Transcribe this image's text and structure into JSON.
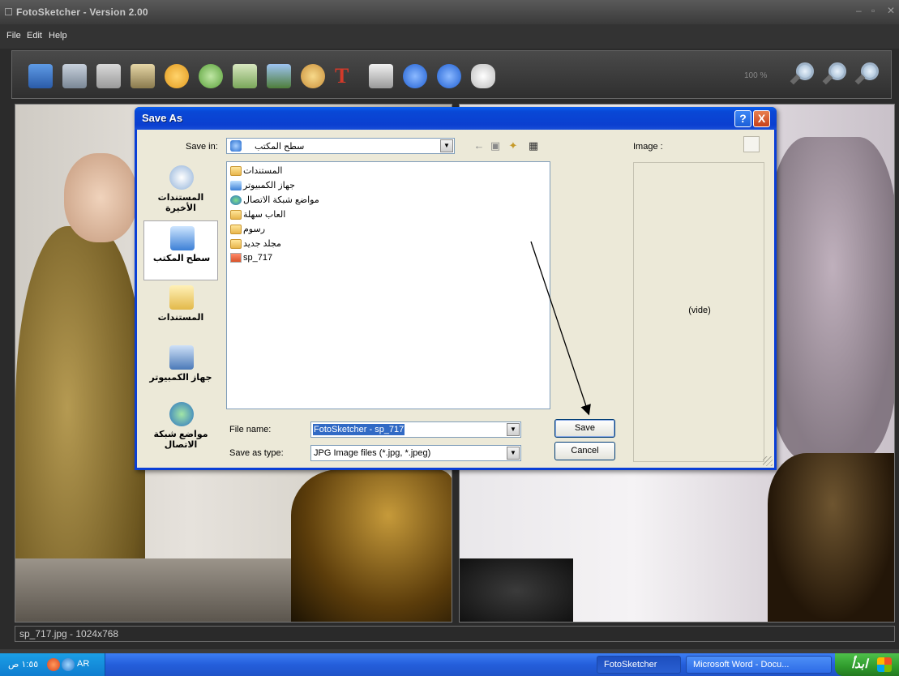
{
  "app": {
    "title": "FotoSketcher - Version 2.00",
    "menu": [
      "File",
      "Edit",
      "Help"
    ],
    "zoom_level": "100 %",
    "status": "sp_717.jpg - 1024x768"
  },
  "dialog": {
    "title": "Save As",
    "save_in_label": "Save in:",
    "save_in_value": "سطح المكتب",
    "preview_label": "Image :",
    "preview_empty": "(vide)",
    "places": [
      {
        "label": "المستندات الأخيرة",
        "icon": "recent-documents-icon"
      },
      {
        "label": "سطح المكتب",
        "icon": "desktop-icon"
      },
      {
        "label": "المستندات",
        "icon": "my-documents-icon"
      },
      {
        "label": "جهاز الكمبيوتر",
        "icon": "my-computer-icon"
      },
      {
        "label": "مواضع شبكة الاتصال",
        "icon": "network-places-icon"
      }
    ],
    "files": [
      {
        "name": "المستندات",
        "icon": "folder-icon"
      },
      {
        "name": "جهاز الكمبيوتر",
        "icon": "computer-icon"
      },
      {
        "name": "مواضع شبكة الاتصال",
        "icon": "network-icon"
      },
      {
        "name": "العاب سهلة",
        "icon": "folder-icon"
      },
      {
        "name": "رسوم",
        "icon": "folder-icon"
      },
      {
        "name": "مجلد جديد",
        "icon": "folder-icon"
      },
      {
        "name": "sp_717",
        "icon": "jpg-file-icon"
      }
    ],
    "file_name_label": "File name:",
    "file_name_value": "FotoSketcher - sp_717",
    "save_type_label": "Save as type:",
    "save_type_value": "JPG Image files (*.jpg, *.jpeg)",
    "save_button": "Save",
    "cancel_button": "Cancel",
    "help_button": "?",
    "close_button": "X"
  },
  "taskbar": {
    "clock": "١:٥٥ ص",
    "language": "AR",
    "tasks": [
      "FotoSketcher",
      "Microsoft Word - Docu..."
    ],
    "start_label": "ابدأ"
  }
}
